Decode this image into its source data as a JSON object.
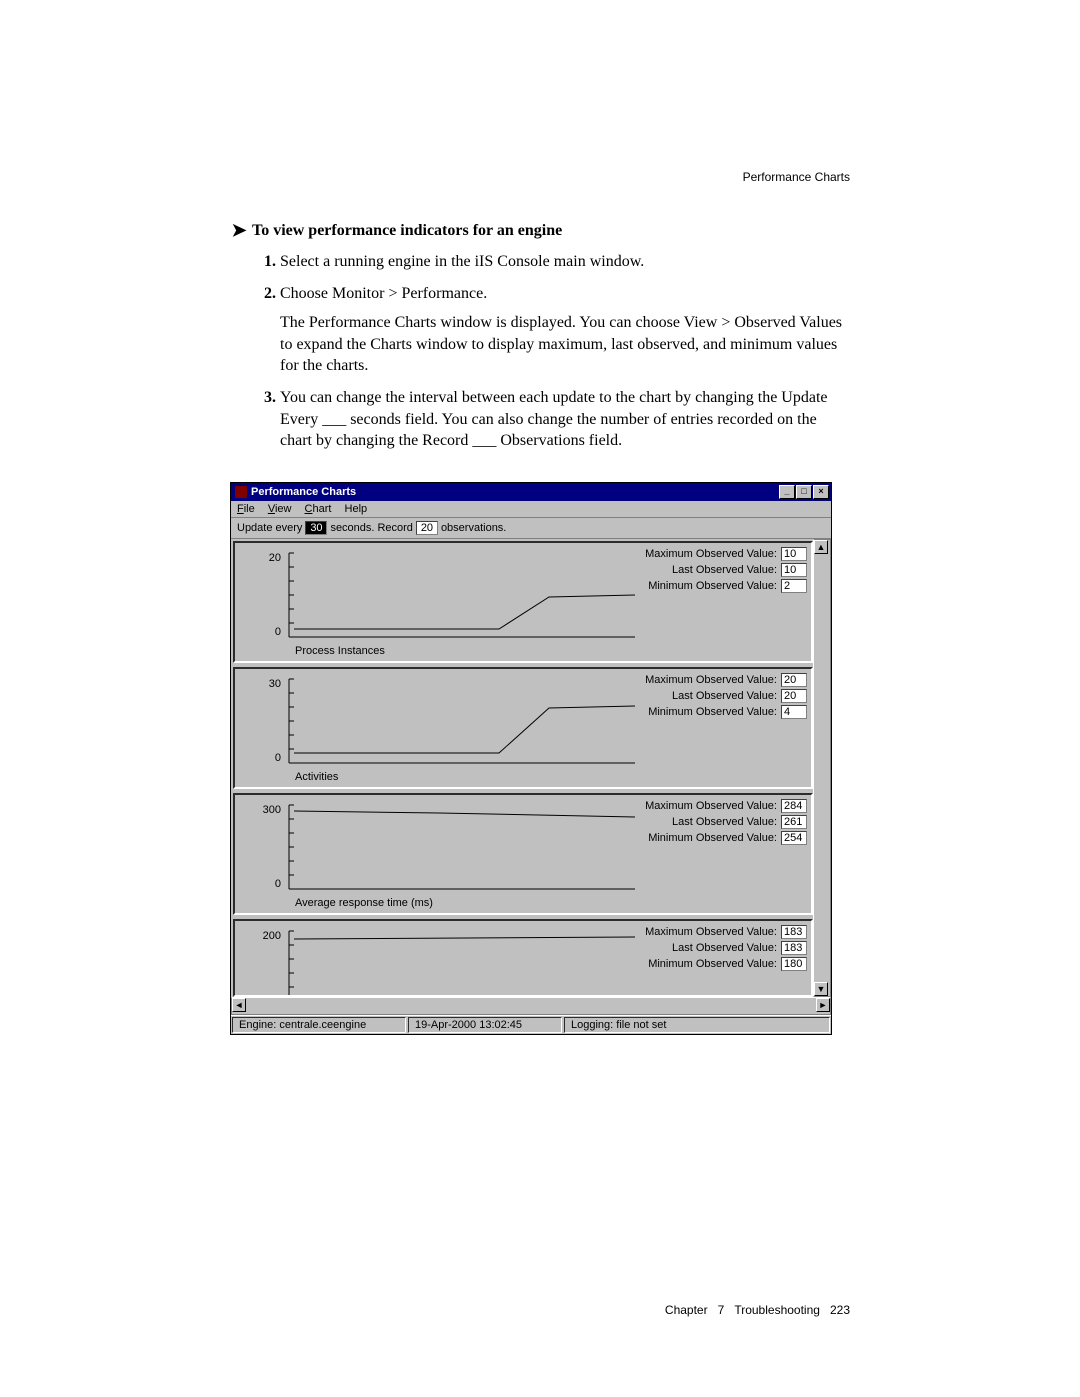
{
  "header": {
    "section": "Performance Charts"
  },
  "task": {
    "title": "To view performance indicators for an engine",
    "steps": [
      {
        "text": "Select a running engine in the iIS Console main window."
      },
      {
        "text": "Choose Monitor > Performance.",
        "after": "The Performance Charts window is displayed. You can choose View > Observed Values to expand the Charts window to display maximum, last observed, and minimum values for the charts."
      },
      {
        "text": "You can change the interval between each update to the chart by changing the Update Every ___ seconds field. You can also change the number of entries recorded on the chart by changing the Record ___ Observations field."
      }
    ]
  },
  "window": {
    "title": "Performance Charts",
    "menus": {
      "file": "File",
      "view": "View",
      "chart": "Chart",
      "help": "Help"
    },
    "toolbar": {
      "label_update": "Update every",
      "value_update": "30",
      "label_seconds": "seconds.",
      "label_record": "Record",
      "value_record": "20",
      "label_obs": "observations."
    },
    "stats_labels": {
      "max": "Maximum Observed Value:",
      "last": "Last Observed Value:",
      "min": "Minimum Observed Value:"
    },
    "charts": [
      {
        "caption": "Process Instances",
        "ymax_tick": "20",
        "ymin_tick": "0",
        "max": "10",
        "last": "10",
        "min": "2"
      },
      {
        "caption": "Activities",
        "ymax_tick": "30",
        "ymin_tick": "0",
        "max": "20",
        "last": "20",
        "min": "4"
      },
      {
        "caption": "Average response time (ms)",
        "ymax_tick": "300",
        "ymin_tick": "0",
        "max": "284",
        "last": "261",
        "min": "254"
      },
      {
        "caption": "",
        "ymax_tick": "200",
        "ymin_tick": "",
        "max": "183",
        "last": "183",
        "min": "180"
      }
    ],
    "status": {
      "engine": "Engine: centrale.ceengine",
      "time": "19-Apr-2000 13:02:45",
      "logging": "Logging: file not set"
    }
  },
  "footer": {
    "chapter": "Chapter",
    "num": "7",
    "title": "Troubleshooting",
    "page": "223"
  },
  "chart_data": [
    {
      "type": "line",
      "title": "Process Instances",
      "ylim": [
        0,
        20
      ],
      "series": [
        {
          "name": "Process Instances",
          "values": [
            2,
            2,
            2,
            2,
            2,
            2,
            2,
            2,
            2,
            2,
            2,
            2,
            3,
            6,
            9,
            10,
            10,
            10,
            10,
            10
          ]
        }
      ],
      "max_observed": 10,
      "last_observed": 10,
      "min_observed": 2
    },
    {
      "type": "line",
      "title": "Activities",
      "ylim": [
        0,
        30
      ],
      "series": [
        {
          "name": "Activities",
          "values": [
            4,
            4,
            4,
            4,
            4,
            4,
            4,
            4,
            4,
            4,
            4,
            4,
            6,
            12,
            18,
            20,
            20,
            20,
            20,
            20
          ]
        }
      ],
      "max_observed": 20,
      "last_observed": 20,
      "min_observed": 4
    },
    {
      "type": "line",
      "title": "Average response time (ms)",
      "ylim": [
        0,
        300
      ],
      "series": [
        {
          "name": "Average response time (ms)",
          "values": [
            284,
            284,
            284,
            283,
            282,
            281,
            280,
            279,
            278,
            276,
            274,
            272,
            270,
            268,
            266,
            265,
            264,
            263,
            262,
            261
          ]
        }
      ],
      "max_observed": 284,
      "last_observed": 261,
      "min_observed": 254
    },
    {
      "type": "line",
      "title": "(fourth chart — partially visible)",
      "ylim": [
        0,
        200
      ],
      "series": [
        {
          "name": "",
          "values": [
            180,
            180,
            181,
            181,
            181,
            182,
            182,
            182,
            183,
            183,
            183,
            183,
            183,
            183,
            183,
            183,
            183,
            183,
            183,
            183
          ]
        }
      ],
      "max_observed": 183,
      "last_observed": 183,
      "min_observed": 180
    }
  ]
}
